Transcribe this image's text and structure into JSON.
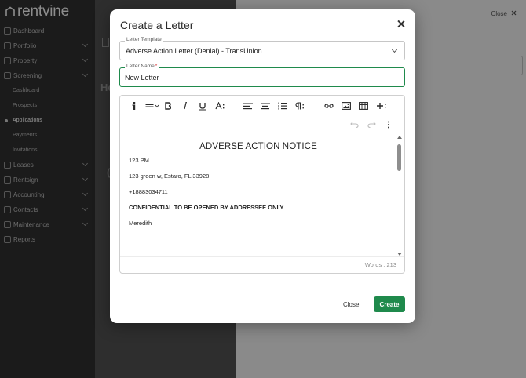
{
  "app": {
    "brand": "rentvine",
    "sidebar": {
      "items": [
        {
          "label": "Dashboard"
        },
        {
          "label": "Portfolio"
        },
        {
          "label": "Property"
        },
        {
          "label": "Screening"
        },
        {
          "label": "Dashboard",
          "sub": true
        },
        {
          "label": "Prospects",
          "sub": true
        },
        {
          "label": "Applications",
          "sub": true,
          "active": true
        },
        {
          "label": "Payments",
          "sub": true
        },
        {
          "label": "Invitations",
          "sub": true
        },
        {
          "label": "Leases"
        },
        {
          "label": "Rentsign"
        },
        {
          "label": "Accounting"
        },
        {
          "label": "Contacts"
        },
        {
          "label": "Maintenance"
        },
        {
          "label": "Reports"
        }
      ]
    },
    "main": {
      "heading_fragment": "He",
      "heading_fragment2": "("
    },
    "drawer": {
      "close_label": "Close"
    }
  },
  "modal": {
    "title": "Create a Letter",
    "template_field": {
      "label": "Letter Template",
      "value": "Adverse Action Letter (Denial) - TransUnion"
    },
    "name_field": {
      "label": "Letter Name",
      "required_mark": "*",
      "value": "New Letter"
    },
    "editor": {
      "toolbar": [
        {
          "name": "info-icon"
        },
        {
          "name": "insert-block-icon"
        },
        {
          "name": "bold-icon"
        },
        {
          "name": "italic-icon"
        },
        {
          "name": "underline-icon"
        },
        {
          "name": "font-size-icon"
        },
        {
          "name": "align-left-icon"
        },
        {
          "name": "align-center-icon"
        },
        {
          "name": "ordered-list-icon"
        },
        {
          "name": "paragraph-icon"
        },
        {
          "name": "link-icon"
        },
        {
          "name": "image-icon"
        },
        {
          "name": "table-icon"
        },
        {
          "name": "insert-more-icon"
        },
        {
          "name": "undo-icon"
        },
        {
          "name": "redo-icon"
        },
        {
          "name": "more-options-icon"
        }
      ],
      "content": {
        "heading": "ADVERSE ACTION NOTICE",
        "paragraphs": [
          "123 PM",
          "123 green w, Estaro, FL 33928",
          "+18883034711",
          "CONFIDENTIAL TO BE OPENED BY ADDRESSEE ONLY",
          "Meredith"
        ]
      },
      "word_count": "Words : 213"
    },
    "close_label": "Close",
    "create_label": "Create",
    "colors": {
      "accent": "#1f8a4c",
      "required": "#d32f2f"
    }
  }
}
